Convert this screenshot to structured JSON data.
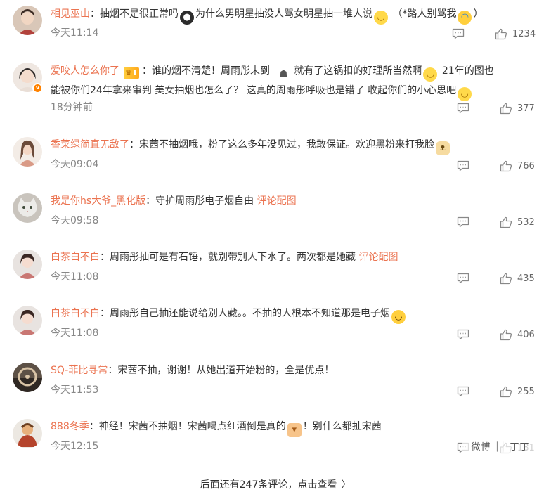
{
  "comments": [
    {
      "username": "相见巫山",
      "segments": [
        "：抽烟不是很正常吗",
        "为什么男明星抽没人骂女明星抽一堆人说",
        "（*路人别骂我",
        "）"
      ],
      "time": "今天11:14",
      "likes": "1234",
      "emojis": [
        "ghost-emoji",
        "smile-emoji",
        "cry-emoji"
      ]
    },
    {
      "username": "爱咬人怎么你了",
      "badge": "I",
      "segments": [
        "：谁的烟不清楚！周雨彤未到",
        "就有了这锅扣的好理所当然啊",
        "21年的图也",
        "能被你们24年拿来审判 美女抽烟也怎么了？ 这真的周雨彤呼吸也是错了 收起你们的小心思吧"
      ],
      "time": "18分钟前",
      "likes": "377",
      "emojis": [
        "hat-emoji",
        "smile-emoji",
        "smile-emoji"
      ]
    },
    {
      "username": "香菜绿简直无敌了",
      "segments": [
        "：宋茜不抽烟哦，粉了这么多年没见过，我敢保证。欢迎黑粉来打我脸"
      ],
      "time": "今天09:04",
      "likes": "766",
      "emojis": [
        "cat-emoji"
      ]
    },
    {
      "username": "我是你hs大爷_黑化版",
      "segments": [
        "：守护周雨彤电子烟自由",
        "评论配图"
      ],
      "time": "今天09:58",
      "likes": "532"
    },
    {
      "username": "白茶白不白",
      "segments": [
        "：周雨彤抽可是有石锤，就别带别人下水了。两次都是她藏",
        "评论配图"
      ],
      "time": "今天11:08",
      "likes": "435"
    },
    {
      "username": "白茶白不白",
      "segments": [
        "：周雨彤自己抽还能说给别人藏。。不抽的人根本不知道那是电子烟"
      ],
      "time": "今天11:08",
      "likes": "406",
      "emojis": [
        "laugh-emoji"
      ]
    },
    {
      "username": "SQ-菲比寻常",
      "segments": [
        "：宋茜不抽，谢谢！从她出道开始粉的，全是优点！"
      ],
      "time": "今天11:53",
      "likes": "255"
    },
    {
      "username": "888冬季",
      "segments": [
        "：神经！宋茜不抽烟！宋茜喝点红酒倒是真的",
        "！别什么都扯宋茜"
      ],
      "time": "今天12:15",
      "likes": "181",
      "emojis": [
        "thumbs-down-emoji"
      ]
    }
  ],
  "more_comments": {
    "label": "后面还有247条评论，点击查看",
    "arrow": "〉"
  },
  "watermark": "微博 ⏐⏐ 丁丁"
}
